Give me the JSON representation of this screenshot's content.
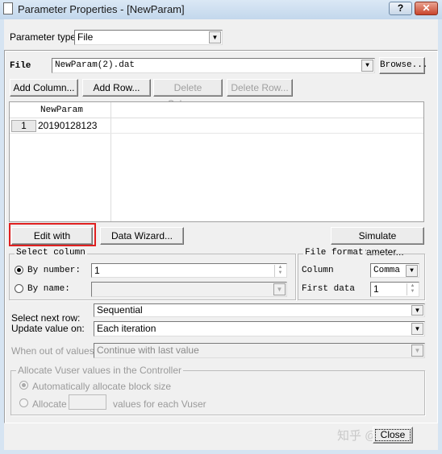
{
  "window": {
    "title": "Parameter Properties - [NewParam]",
    "help": "?",
    "close": "✕"
  },
  "param_type": {
    "label": "Parameter type:",
    "value": "File"
  },
  "file": {
    "label": "File",
    "value": "NewParam(2).dat",
    "browse": "Browse..."
  },
  "toolbar": {
    "add_column": "Add Column...",
    "add_row": "Add Row...",
    "delete_column": "Delete Column...",
    "delete_row": "Delete Row..."
  },
  "grid": {
    "columns": [
      "NewParam"
    ],
    "rows": [
      {
        "index": "1",
        "values": [
          "20190128123"
        ]
      }
    ]
  },
  "actions": {
    "edit_notepad": "Edit with Notepad...",
    "data_wizard": "Data Wizard...",
    "simulate": "Simulate Parameter..."
  },
  "select_column": {
    "title": "Select column",
    "by_number": "By number:",
    "by_number_value": "1",
    "by_name": "By name:",
    "selected": "by_number"
  },
  "file_format": {
    "title": "File format",
    "column_label": "Column",
    "column_value": "Comma",
    "first_data_label": "First data",
    "first_data_value": "1"
  },
  "next_row": {
    "label": "Select next row:",
    "value": "Sequential"
  },
  "update": {
    "label": "Update value on:",
    "value": "Each iteration"
  },
  "out_of_values": {
    "label": "When out of values:",
    "value": "Continue with last value"
  },
  "allocate": {
    "title": "Allocate Vuser values in the Controller",
    "auto": "Automatically allocate block size",
    "manual": "Allocate",
    "manual_suffix": "values for each Vuser"
  },
  "close_button": "Close",
  "watermark": "知乎 @"
}
